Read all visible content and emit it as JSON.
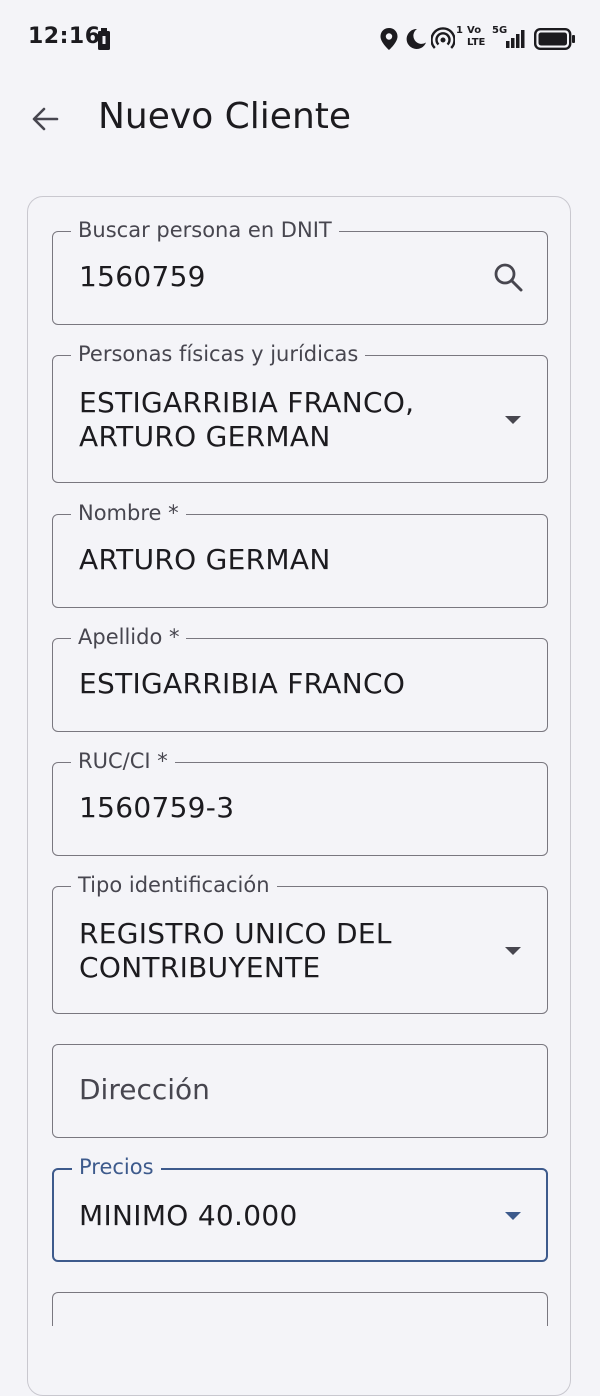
{
  "status_bar": {
    "time": "12:16",
    "sim_slot": "1",
    "volte_top": "Vo",
    "volte_bottom": "LTE",
    "network": "5G"
  },
  "app_bar": {
    "title": "Nuevo Cliente"
  },
  "form": {
    "search": {
      "label": "Buscar persona en DNIT",
      "value": "1560759"
    },
    "persona": {
      "label": "Personas físicas y jurídicas",
      "value_line1": "ESTIGARRIBIA FRANCO,",
      "value_line2": "ARTURO GERMAN"
    },
    "nombre": {
      "label": "Nombre *",
      "value": "ARTURO GERMAN"
    },
    "apellido": {
      "label": "Apellido *",
      "value": "ESTIGARRIBIA FRANCO"
    },
    "ruc": {
      "label": "RUC/CI *",
      "value": "1560759-3"
    },
    "tipo_identificacion": {
      "label": "Tipo identificación",
      "value_line1": "REGISTRO UNICO DEL",
      "value_line2": "CONTRIBUYENTE"
    },
    "direccion": {
      "placeholder": "Dirección"
    },
    "precios": {
      "label": "Precios",
      "value": "MINIMO 40.000"
    }
  },
  "colors": {
    "background": "#f4f4f8",
    "focused_border": "#3d5a8c",
    "outline": "#79777f"
  }
}
